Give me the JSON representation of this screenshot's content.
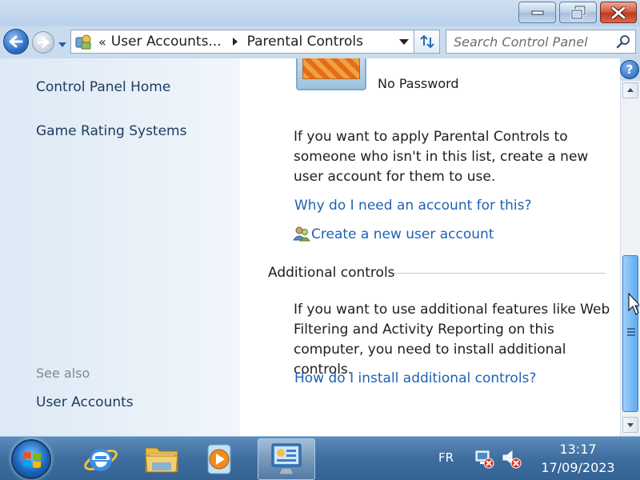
{
  "window": {
    "controls": {
      "minimize": "minimize",
      "maximize": "restore",
      "close": "close"
    }
  },
  "address": {
    "overflow": "«",
    "crumbs": [
      "User Accounts...",
      "Parental Controls"
    ],
    "search_placeholder": "Search Control Panel"
  },
  "sidebar": {
    "links": [
      "Control Panel Home",
      "Game Rating Systems"
    ],
    "see_also_heading": "See also",
    "see_also_links": [
      "User Accounts"
    ]
  },
  "main": {
    "account_status": "No Password",
    "intro_text": "If you want to apply Parental Controls to someone who isn't in this list, create a new user account for them to use.",
    "why_link": "Why do I need an account for this?",
    "create_link": "Create a new user account",
    "additional_heading": "Additional controls",
    "additional_text": "If you want to use additional features like Web Filtering and Activity Reporting on this computer, you need to install additional controls.",
    "install_link": "How do I install additional controls?"
  },
  "taskbar": {
    "apps": [
      "internet-explorer",
      "windows-explorer",
      "media-player",
      "control-panel"
    ],
    "active_app": "control-panel",
    "language": "FR",
    "time": "13:17",
    "date": "17/09/2023"
  },
  "colors": {
    "link": "#1f62b4",
    "sidebar_link": "#1e3b60",
    "accent": "#3f80c9"
  }
}
